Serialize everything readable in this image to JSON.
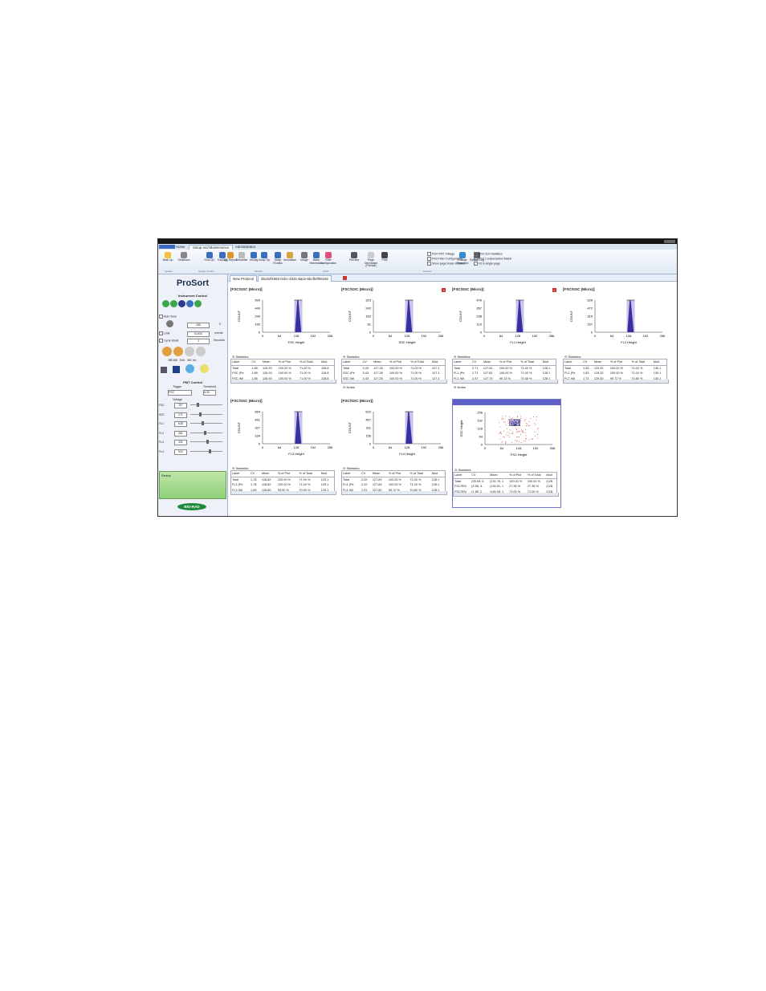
{
  "app": {
    "tabs": [
      "Home",
      "Setup and Maintenance",
      "Administrator"
    ],
    "active_tab": "Setup and Maintenance"
  },
  "ribbon": {
    "buttons": [
      "Back Up",
      "Shutdown",
      "Flow QC",
      "Tracking",
      "QC Report",
      "Debubble",
      "Unclog",
      "Swap Tip",
      "Swap Fluidics",
      "Annotation",
      "Image",
      "Basic Information",
      "Filter Configuration",
      "Preview",
      "Page Orientation (Portrait)",
      "Print",
      "Change Password",
      "System Log"
    ],
    "groups": [
      "System",
      "Quality Control",
      "Fluidics",
      "Other",
      "Reports"
    ],
    "checkboxes": [
      "Print PMT Voltage",
      "Print Filter Configuration",
      "Show page break indicator",
      "Print Sort Statistics",
      "Print Compensation Matrix",
      "Fit to single page"
    ]
  },
  "sidebar": {
    "logo": "ProSort",
    "section_title": "Instrument Control",
    "auto_save": "Auto Save",
    "limit_label": "Limit",
    "cycle_mode": "Cycle Mode",
    "value1": "150",
    "value1_unit": "0",
    "events": "5,000",
    "events_unit": "events",
    "cycle_value": "1",
    "cycle_unit": "Seconds",
    "lasers": [
      "488 488",
      "Drift",
      "561 nm"
    ],
    "pmt_title": "PMT Control",
    "trigger_label": "Trigger",
    "threshold_label": "Threshold",
    "trigger_value": "FSC",
    "threshold_value": "5.00",
    "voltage_label": "Voltage",
    "voltages": [
      {
        "ch": "FSC",
        "v": "297"
      },
      {
        "ch": "SSC",
        "v": "271"
      },
      {
        "ch": "FL1",
        "v": "628"
      },
      {
        "ch": "FL2",
        "v": "481"
      },
      {
        "ch": "FL3",
        "v": "431"
      },
      {
        "ch": "FL4",
        "v": "524"
      }
    ],
    "status": "Ready",
    "brand": "BIO-RAD"
  },
  "doc_tabs": [
    "New Protocol",
    "3bc62f4982-0cbc-4b31-8acb-6bcfb0f6518e"
  ],
  "panels": [
    {
      "title": "[FSC/SSC (Micro)]",
      "x_label": "FSC Height",
      "yticks": [
        "590",
        "449",
        "299",
        "150",
        "0"
      ],
      "close": false,
      "rows": [
        [
          "Total",
          "1.85",
          "126.93",
          "100.00 %",
          "71.00 %",
          "128.8"
        ],
        [
          "FSC (Pe",
          "1.85",
          "126.93",
          "100.00 %",
          "71.00 %",
          "128.8"
        ],
        [
          "FSC (Mi",
          "1.85",
          "126.93",
          "100.00 %",
          "71.00 %",
          "128.8"
        ]
      ],
      "notes": false
    },
    {
      "title": "[FSC/SSC (Micro)]",
      "x_label": "SSC Height",
      "yticks": [
        "323",
        "242",
        "162",
        "81",
        "0"
      ],
      "close": true,
      "rows": [
        [
          "Total",
          "3.43",
          "127.26",
          "100.00 %",
          "71.00 %",
          "127.1"
        ],
        [
          "SSC (Pe",
          "3.43",
          "127.26",
          "100.00 %",
          "71.00 %",
          "127.1"
        ],
        [
          "SSC (Mi",
          "3.43",
          "127.26",
          "100.00 %",
          "71.00 %",
          "127.1"
        ]
      ],
      "notes": true
    },
    {
      "title": "[FSC/SSC (Micro)]",
      "x_label": "FL1 Height",
      "yticks": [
        "476",
        "357",
        "238",
        "119",
        "0"
      ],
      "close": true,
      "rows": [
        [
          "Total",
          "2.71",
          "127.81",
          "100.00 %",
          "71.00 %",
          "128.1"
        ],
        [
          "FL1 (Pe",
          "2.71",
          "127.81",
          "100.00 %",
          "71.00 %",
          "128.1"
        ],
        [
          "FL1 (Mi",
          "2.47",
          "127.79",
          "99.13 %",
          "70.38 %",
          "128.1"
        ]
      ],
      "notes": true
    },
    {
      "title": "[FSC/SSC (Micro)]",
      "x_label": "FL2 Height",
      "yticks": [
        "629",
        "472",
        "315",
        "157",
        "0"
      ],
      "close": false,
      "rows": [
        [
          "Total",
          "1.83",
          "129.32",
          "100.00 %",
          "71.00 %",
          "130.1"
        ],
        [
          "FL2 (Pe",
          "1.83",
          "129.32",
          "100.00 %",
          "71.00 %",
          "130.1"
        ],
        [
          "FL2 (Mi",
          "1.73",
          "129.30",
          "99.72 %",
          "70.80 %",
          "130.1"
        ]
      ],
      "notes": false
    },
    {
      "title": "[FSC/SSC (Micro)]",
      "x_label": "FL3 Height",
      "yticks": [
        "654",
        "491",
        "327",
        "164",
        "0"
      ],
      "close": false,
      "rows": [
        [
          "Total",
          "1.78",
          "128.82",
          "100.00 %",
          "71.00 %",
          "129.1"
        ],
        [
          "FL3 (Pe",
          "1.78",
          "128.82",
          "100.00 %",
          "71.00 %",
          "129.1"
        ],
        [
          "FL3 (Mi",
          "1.69",
          "128.80",
          "99.90 %",
          "70.90 %",
          "129.1"
        ]
      ],
      "notes": false
    },
    {
      "title": "[FSC/SSC (Micro)]",
      "x_label": "FL4 Height",
      "yticks": [
        "622",
        "467",
        "311",
        "156",
        "0"
      ],
      "close": false,
      "rows": [
        [
          "Total",
          "2.02",
          "127.83",
          "100.00 %",
          "71.00 %",
          "128.1"
        ],
        [
          "FL4 (Pe",
          "2.02",
          "127.83",
          "100.00 %",
          "71.00 %",
          "128.1"
        ],
        [
          "FL4 (Mi",
          "1.91",
          "127.82",
          "99.72 %",
          "70.80 %",
          "128.1"
        ]
      ],
      "notes": false
    },
    {
      "title": "",
      "x_label": "FSC Height",
      "y_label": "SSC Height",
      "yticks": [
        "256",
        "192",
        "128",
        "64",
        "0"
      ],
      "close": false,
      "scatter": true,
      "rows": [
        [
          "Total",
          "(35.53, 3.",
          "(131.76, 1",
          "100.00 %",
          "100.00 %",
          "(128."
        ],
        [
          "FSC/SSt",
          "(3.58, 3.",
          "(126.91, 1",
          "27.36 %",
          "27.36 %",
          "(128."
        ],
        [
          "FSC/SSt",
          "(1.85, 2.",
          "(126.93, 1",
          "71.00 %",
          "71.00 %",
          "(128."
        ]
      ],
      "notes": false
    }
  ],
  "stat_headers": [
    "Label",
    "CV",
    "Mean",
    "% of Plot",
    "% of Total",
    "Mod"
  ],
  "xticks": [
    "0",
    "64",
    "128",
    "192",
    "256"
  ],
  "y_axis": "COUNT",
  "statistics_label": "Statistics",
  "notes_label": "Notes",
  "colors": {
    "accent": "#5b5fc7",
    "hist": "#3a2fa0",
    "gate": "#c7c3ea",
    "status_green": "#8fd07a"
  }
}
